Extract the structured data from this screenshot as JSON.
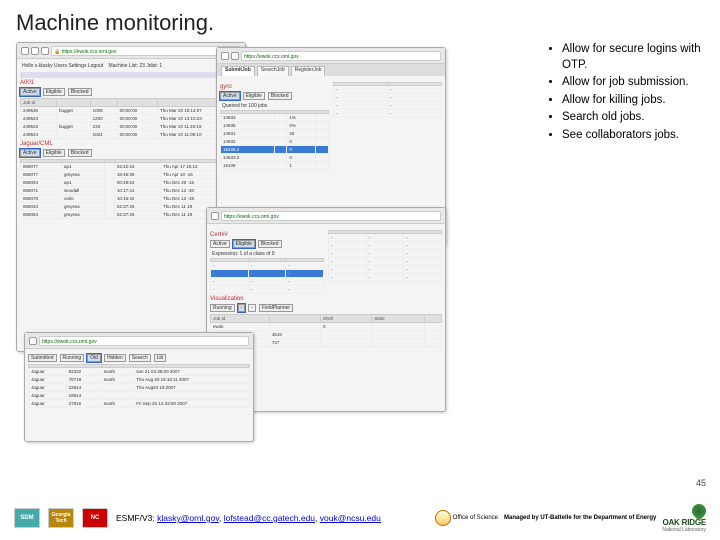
{
  "title": "Machine monitoring.",
  "bullets": [
    "Allow for secure logins with OTP.",
    "Allow for job submission.",
    "Allow for killing jobs.",
    "Search old jobs.",
    "See collaborators jobs."
  ],
  "page_number": "45",
  "footer": {
    "project": "ESMF/V3:",
    "emails": [
      "klasky@ornl.gov",
      "lofstead@cc.gatech.edu",
      "vouk@ncsu.edu"
    ],
    "managed": "Managed by UT-Battelle for the Department of Energy",
    "logos": {
      "sdm": "SDM",
      "gt": "Georgia Tech",
      "ncsu": "NC",
      "sci": "Office of Science",
      "ornl": "OAK RIDGE",
      "ornl_sub": "National Laboratory"
    }
  },
  "browser_a": {
    "url": "https://ewok.ccs.ornl.gov",
    "header": "Hello s.klasky   Users Settings   Logout",
    "sub": "Machine List: 23    Jdist: 1",
    "tabs": [
      "Active",
      "Eligible",
      "Blocked"
    ],
    "table_cols": [
      "Job Id",
      "",
      "",
      "",
      ""
    ],
    "rows": [
      [
        "249535",
        "bugget",
        "1008",
        "00:00:00",
        "Thu Mar 20 10:14:07"
      ],
      [
        "249523",
        "",
        "1200",
        "00:00:00",
        "Thu Mar 20 14:10:23"
      ],
      [
        "249522",
        "bugget",
        "233",
        "00:00:00",
        "Thu Mar 20 11:49:18"
      ],
      [
        "249524",
        "",
        "1024",
        "00:00:00",
        "Thu Mar 20 11:09:10"
      ]
    ],
    "sect2": "Jaguar/CML",
    "rows2": [
      [
        "868077",
        "ap1",
        "",
        "02:42:43",
        "Thu Apr 17 16:12"
      ],
      [
        "868077",
        "gmyeas",
        "",
        "18:46:39",
        "Thu Apr 10 -16"
      ],
      [
        "868004",
        "ap1",
        "",
        "00:48:54",
        "Thu Dec 20 -16"
      ],
      [
        "868071",
        "woodall",
        "",
        "10:17:41",
        "Thu Dec 12 -20"
      ],
      [
        "868078",
        "oolio",
        "",
        "10:16:42",
        "Thu Dec 12 -18"
      ],
      [
        "868034",
        "gmyeas",
        "",
        "02:37:25",
        "Thu Dec 11 18"
      ],
      [
        "868054",
        "gmyeas",
        "",
        "02:37:26",
        "Thu Dec 11 18"
      ]
    ]
  },
  "browser_b": {
    "url": "https://ewok.ccs.ornl.gov",
    "tabs_top": [
      "SubmitJob",
      "SearchJob",
      "RegisterJob"
    ],
    "sect": "gyro",
    "tabs": [
      "Active",
      "Eligible",
      "Blocked"
    ],
    "info": "Queried for 100 jobs",
    "rows": [
      [
        "14933",
        "",
        "1%",
        ""
      ],
      [
        "14935",
        "",
        "0%",
        ""
      ],
      [
        "14931",
        "",
        "25",
        ""
      ],
      [
        "14932",
        "",
        "0",
        ""
      ],
      [
        "16428.2",
        "",
        "0",
        ""
      ],
      [
        "14533.2",
        "",
        "0",
        ""
      ],
      [
        "15109",
        "",
        "1",
        ""
      ]
    ]
  },
  "browser_c": {
    "url": "https://ewok.ccs.ornl.gov",
    "sect": "Cert##",
    "tabs": [
      "Active",
      "Eligible",
      "Blocked"
    ],
    "info": "Expression: 1 of a class of 9",
    "split_l_cols": [
      "",
      "",
      "",
      "",
      ""
    ],
    "split_l": [
      [
        "",
        "",
        "",
        "",
        ""
      ],
      [
        "",
        "",
        "",
        "",
        ""
      ],
      [
        "",
        "",
        "",
        "",
        ""
      ],
      [
        "",
        "",
        "",
        "",
        ""
      ]
    ],
    "sect2": "Visualization",
    "bottom_tabs": [
      "Running",
      "",
      "",
      "FieldPlanner"
    ],
    "rows2": [
      [
        "ewok",
        "",
        "0",
        "",
        ""
      ],
      [
        "ewok",
        "4516",
        "",
        "",
        ""
      ],
      [
        "",
        "727",
        "",
        "",
        ""
      ]
    ]
  },
  "browser_d": {
    "url": "https://ewok.ccs.ornl.gov",
    "tabs": [
      "Submitted",
      "Running",
      "Old",
      "Hidden",
      "Search",
      "Lib"
    ],
    "rows": [
      [
        "Jaguar",
        "82332",
        "neuth",
        "sun 21 04:38:00 2007"
      ],
      [
        "Jaguar",
        "78718",
        "neuth",
        "Thu Aug 30 16:18:11 2007"
      ],
      [
        "Jaguar",
        "22814",
        "",
        "Thu Aug04 18:2007"
      ],
      [
        "Jaguar",
        "18814",
        "",
        ""
      ],
      [
        "Jaguar",
        "27816",
        "neuth",
        "Fri Sep 26 14:33:08 2007"
      ]
    ]
  }
}
